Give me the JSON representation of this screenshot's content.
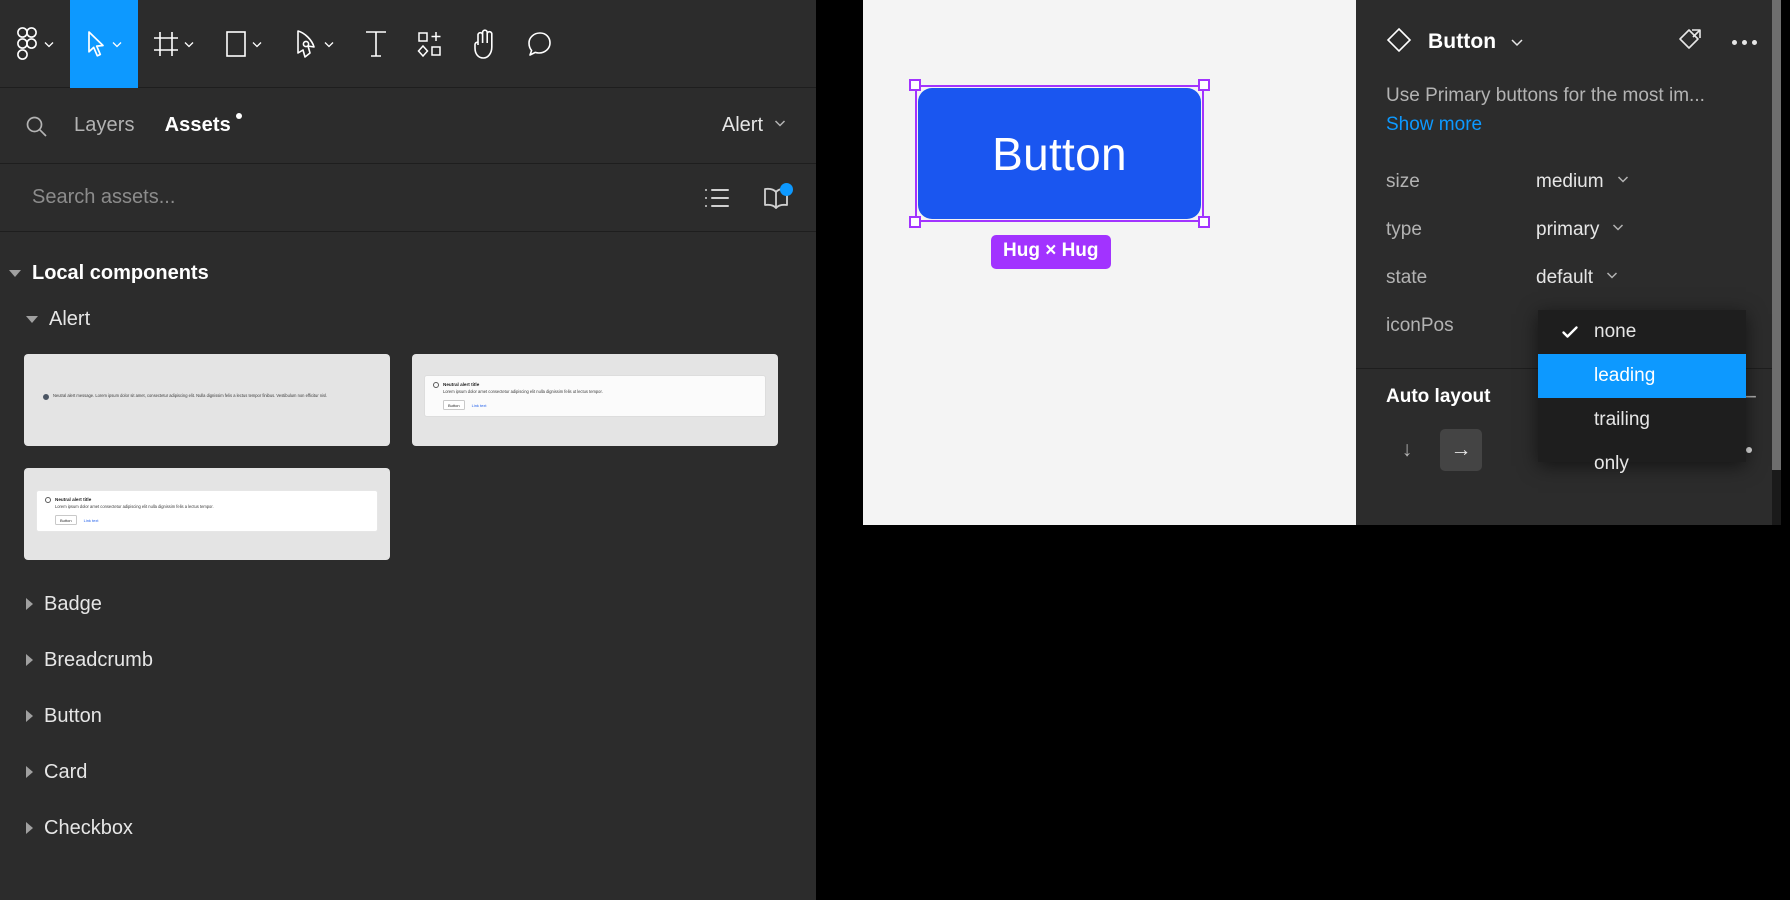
{
  "toolbar": {
    "tools": [
      {
        "name": "figma-logo-icon",
        "caret": true
      },
      {
        "name": "move-tool-icon",
        "caret": true,
        "active": true
      },
      {
        "name": "frame-tool-icon",
        "caret": true
      },
      {
        "name": "shape-tool-icon",
        "caret": true
      },
      {
        "name": "pen-tool-icon",
        "caret": true
      },
      {
        "name": "text-tool-icon",
        "caret": false
      },
      {
        "name": "actions-tool-icon",
        "caret": false
      },
      {
        "name": "hand-tool-icon",
        "caret": false
      },
      {
        "name": "comment-tool-icon",
        "caret": false
      }
    ]
  },
  "left_panel": {
    "tabs": [
      {
        "label": "Layers",
        "active": false,
        "dot": false
      },
      {
        "label": "Assets",
        "active": true,
        "dot": true
      }
    ],
    "library_select": "Alert",
    "search": {
      "placeholder": "Search assets...",
      "value": ""
    },
    "view_icons": [
      "list-view-icon",
      "libraries-icon"
    ],
    "sections": {
      "local_components": "Local components",
      "alert_group": "Alert"
    },
    "thumbnails": [
      {
        "name": "alert-thumb-inline",
        "body": "Neutral alert message. Lorem ipsum dolor sit amet, consectetur adipiscing elit. Nulla dignissim felis a lectus tempor finibus. Vestibulum non efficitur nisl."
      },
      {
        "name": "alert-thumb-with-actions",
        "title": "Neutral alert title",
        "body": "Lorem ipsum dolor amet consectetur adipiscing elit nulla dignissim felis ut lectus tempor.",
        "button": "Button",
        "link": "Link text"
      },
      {
        "name": "alert-thumb-card",
        "title": "Neutral alert title",
        "body": "Lorem ipsum dolor amet consectetur adipiscing elit nulla dignissim felis a lectus tempor.",
        "button": "Button",
        "link": "Link text"
      }
    ],
    "component_list": [
      "Badge",
      "Breadcrumb",
      "Button",
      "Card",
      "Checkbox"
    ]
  },
  "canvas": {
    "button_label": "Button",
    "size_badge": "Hug × Hug",
    "button_color": "#1a56f0",
    "selection_color": "#a233ff",
    "background": "#f4f4f4"
  },
  "right_panel": {
    "component_name": "Button",
    "header_icons": [
      "component-diamond-icon",
      "chevron-down-icon",
      "detach-instance-icon",
      "more-options-icon"
    ],
    "description": "Use Primary buttons for the most im...",
    "show_more": "Show more",
    "properties": [
      {
        "label": "size",
        "value": "medium"
      },
      {
        "label": "type",
        "value": "primary"
      },
      {
        "label": "state",
        "value": "default"
      },
      {
        "label": "iconPos",
        "value": ""
      }
    ],
    "auto_layout": {
      "title": "Auto layout",
      "collapse": "−",
      "direction_vertical": "↓",
      "direction_horizontal": "→"
    }
  },
  "dropdown": {
    "name": "iconPos-dropdown",
    "items": [
      {
        "label": "none",
        "checked": true,
        "highlighted": false
      },
      {
        "label": "leading",
        "checked": false,
        "highlighted": true
      },
      {
        "label": "trailing",
        "checked": false,
        "highlighted": false
      },
      {
        "label": "only",
        "checked": false,
        "highlighted": false
      }
    ],
    "highlight_color": "#0d99ff"
  }
}
